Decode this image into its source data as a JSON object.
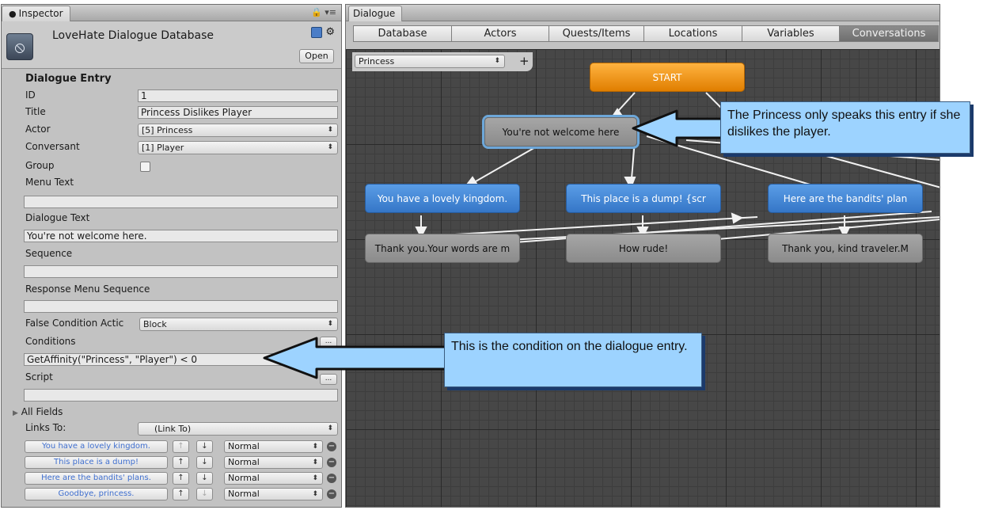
{
  "inspector": {
    "tab_label": "Inspector",
    "object_title": "LoveHate Dialogue Database",
    "open_button": "Open",
    "section_title": "Dialogue Entry",
    "fields": {
      "id_label": "ID",
      "id_value": "1",
      "title_label": "Title",
      "title_value": "Princess Dislikes Player",
      "actor_label": "Actor",
      "actor_value": "[5] Princess",
      "conversant_label": "Conversant",
      "conversant_value": "[1] Player",
      "group_label": "Group",
      "menu_text_label": "Menu Text",
      "menu_text_value": "",
      "dialogue_text_label": "Dialogue Text",
      "dialogue_text_value": "You're not welcome here.",
      "sequence_label": "Sequence",
      "sequence_value": "",
      "response_menu_sequence_label": "Response Menu Sequence",
      "response_menu_sequence_value": "",
      "false_condition_label": "False Condition Actic",
      "false_condition_value": "Block",
      "conditions_label": "Conditions",
      "conditions_value": "GetAffinity(\"Princess\", \"Player\") < 0",
      "script_label": "Script",
      "script_value": "",
      "dots": "..."
    },
    "all_fields_label": "All Fields",
    "links_to_label": "Links To:",
    "links_to_value": "(Link To)",
    "links": [
      {
        "label": "You have a lovely kingdom.",
        "priority": "Normal"
      },
      {
        "label": "This place is a dump!",
        "priority": "Normal"
      },
      {
        "label": "Here are the bandits' plans.",
        "priority": "Normal"
      },
      {
        "label": "Goodbye, princess.",
        "priority": "Normal"
      }
    ],
    "up_arrow": "↑",
    "down_arrow": "↓",
    "remove": "−"
  },
  "dialogue": {
    "tab_label": "Dialogue",
    "toolbar": [
      "Database",
      "Actors",
      "Quests/Items",
      "Locations",
      "Variables",
      "Conversations"
    ],
    "active_toolbar": "Conversations",
    "conversation": "Princess",
    "plus": "+",
    "nodes": {
      "start": "START",
      "entry_1": "You're not welcome here",
      "response_1": "You have a lovely kingdom.",
      "response_2": "This place is a dump! {scr",
      "response_3": "Here are the bandits' plan",
      "reply_1": "Thank you.Your words are m",
      "reply_2": "How rude!",
      "reply_3": "Thank you, kind traveler.M"
    }
  },
  "callouts": {
    "top": "The Princess only speaks this entry if she dislikes the player.",
    "bottom": "This is the condition on the dialogue entry."
  },
  "colors": {
    "callout_fill": "#9dd3ff",
    "start_node": "#f59a10",
    "player_node": "#4a8ad8",
    "npc_node": "#9a9a9a"
  }
}
